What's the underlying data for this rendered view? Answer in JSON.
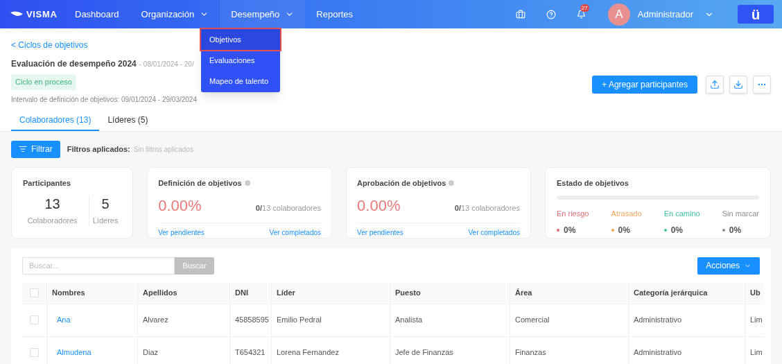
{
  "nav": {
    "logo": "VISMA",
    "items": [
      {
        "label": "Dashboard",
        "dropdown": false,
        "selected": false
      },
      {
        "label": "Organización",
        "dropdown": true,
        "selected": false
      },
      {
        "label": "Desempeño",
        "dropdown": true,
        "selected": true
      },
      {
        "label": "Reportes",
        "dropdown": false,
        "selected": false
      }
    ],
    "notifications": "27",
    "avatar": "A",
    "user": "Administrador",
    "app_button": "ü"
  },
  "dropdown_menu": [
    {
      "label": "Objetivos",
      "selected": true
    },
    {
      "label": "Evaluaciones",
      "selected": false
    },
    {
      "label": "Mapeo de talento",
      "selected": false
    }
  ],
  "back_link": "< Ciclos de objetivos",
  "title": "Evaluación de desempeño 2024",
  "dates": "- 08/01/2024 - 20/",
  "status_badge": "Ciclo en proceso",
  "interval": "Intervalo de definición de objetivos: 09/01/2024 - 29/03/2024",
  "actions": {
    "add": "+ Agregar participantes"
  },
  "tabs": [
    {
      "label": "Colaboradores (13)",
      "selected": true
    },
    {
      "label": "Líderes (5)",
      "selected": false
    }
  ],
  "filter": {
    "button": "Filtrar",
    "label": "Filtros aplicados:",
    "value": "Sin filtros aplicados"
  },
  "participants": {
    "title": "Participantes",
    "stats": [
      {
        "value": "13",
        "label": "Colaboradores"
      },
      {
        "value": "5",
        "label": "Líderes"
      }
    ]
  },
  "progress_cards": [
    {
      "title": "Definición de objetivos",
      "percent": "0.00%",
      "count": "0/",
      "total": "13 colaboradores",
      "pending": "Ver pendientes",
      "completed": "Ver completados"
    },
    {
      "title": "Aprobación de objetivos",
      "percent": "0.00%",
      "count": "0/",
      "total": "13 colaboradores",
      "pending": "Ver pendientes",
      "completed": "Ver completados"
    }
  ],
  "status_card": {
    "title": "Estado de objetivos",
    "items": [
      {
        "label": "En riesgo",
        "value": "0%",
        "color": "#e06c75"
      },
      {
        "label": "Atrasado",
        "value": "0%",
        "color": "#f5a55a"
      },
      {
        "label": "En camino",
        "value": "0%",
        "color": "#3fc1a0"
      },
      {
        "label": "Sin marcar",
        "value": "0%",
        "color": "#8c8c8c"
      }
    ]
  },
  "search": {
    "placeholder": "Buscar...",
    "button": "Buscar"
  },
  "actions_button": "Acciones",
  "table": {
    "select_all_checked": false,
    "columns": [
      "Nombres",
      "Apellidos",
      "DNI",
      "Líder",
      "Puesto",
      "Área",
      "Categoría jerárquica",
      "Ub"
    ],
    "rows": [
      {
        "checked": false,
        "cells": [
          "Ana",
          "Alvarez",
          "45858595",
          "Emilio Pedral",
          "Analista",
          "Comercial",
          "Administrativo",
          "Lim"
        ]
      },
      {
        "checked": false,
        "cells": [
          "Almudena",
          "Diaz",
          "T654321",
          "Lorena Fernandez",
          "Jefe de Finanzas",
          "Finanzas",
          "Administrativo",
          "Lim"
        ]
      }
    ]
  }
}
